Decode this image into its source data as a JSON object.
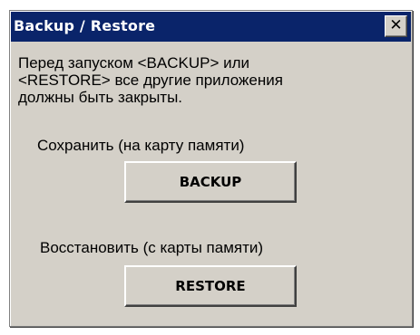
{
  "window": {
    "title": "Backup / Restore",
    "close_label": "✕"
  },
  "message": {
    "lines": [
      "Перед запуском <BACKUP> или",
      "<RESTORE> все другие приложения",
      "должны быть закрыты."
    ]
  },
  "backup": {
    "label": "Сохранить (на карту памяти)",
    "button_label": "BACKUP"
  },
  "restore": {
    "label": "Восстановить (с карты памяти)",
    "button_label": "RESTORE"
  },
  "colors": {
    "titlebar": "#0a246a",
    "window_face": "#d4d0c8"
  },
  "icons": {
    "close": "close-icon"
  }
}
